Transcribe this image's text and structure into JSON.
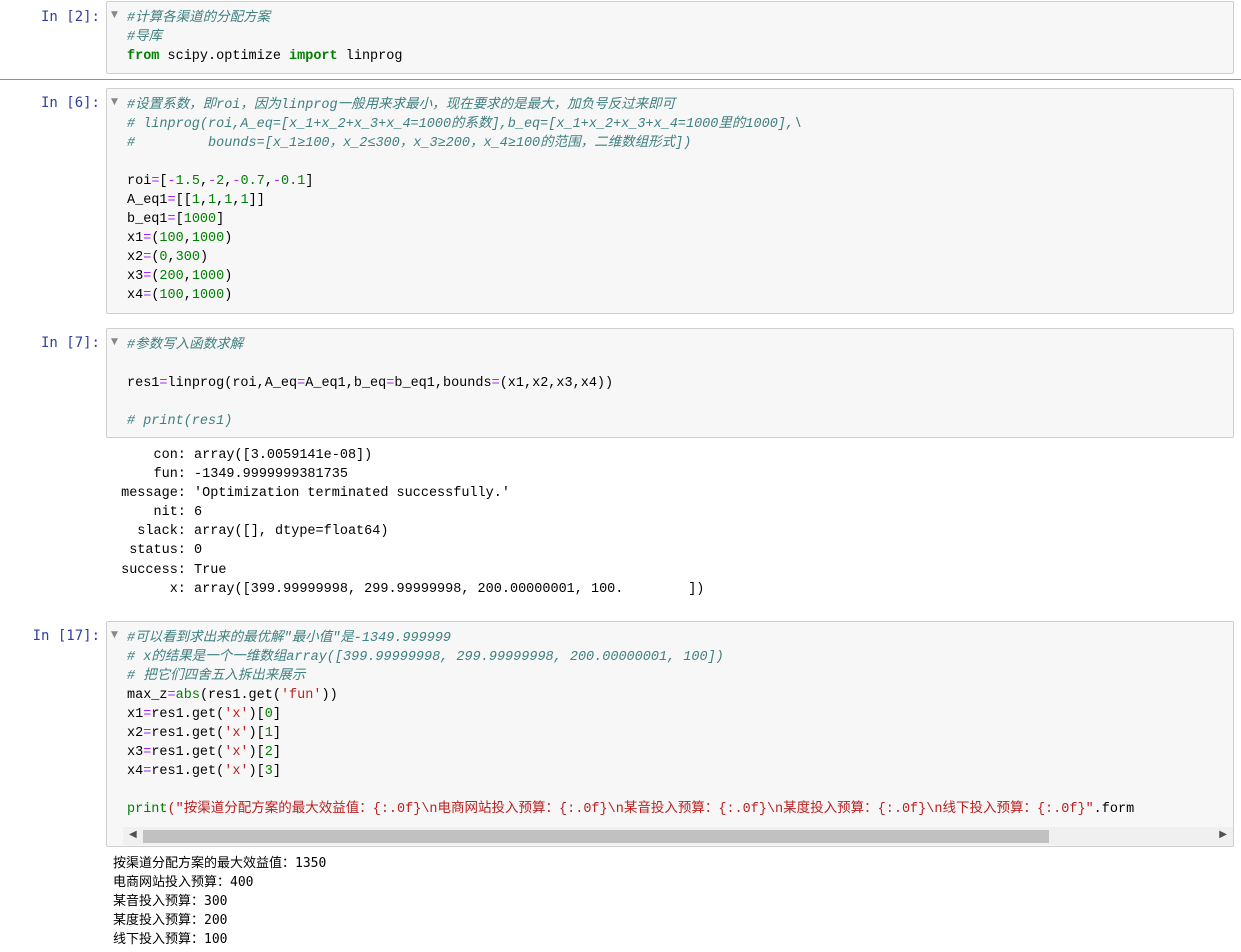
{
  "cells": [
    {
      "prompt": "In  [2]:",
      "lines": [
        [
          {
            "t": "#计算各渠道的分配方案",
            "c": "cm"
          }
        ],
        [
          {
            "t": "#导库",
            "c": "cm"
          }
        ],
        [
          {
            "t": "from",
            "c": "kw"
          },
          {
            "t": " scipy.optimize ",
            "c": ""
          },
          {
            "t": "import",
            "c": "kw"
          },
          {
            "t": " linprog",
            "c": ""
          }
        ]
      ]
    },
    {
      "prompt": "In  [6]:",
      "lines": [
        [
          {
            "t": "#设置系数，即roi，因为linprog一般用来求最小，现在要求的是最大，加负号反过来即可",
            "c": "cm"
          }
        ],
        [
          {
            "t": "# linprog(roi,A_eq=[x_1+x_2+x_3+x_4=1000的系数],b_eq=[x_1+x_2+x_3+x_4=1000里的1000],\\",
            "c": "cm"
          }
        ],
        [
          {
            "t": "#         bounds=[x_1≥100，x_2≤300，x_3≥200，x_4≥100的范围，二维数组形式])",
            "c": "cm"
          }
        ],
        [
          {
            "t": "",
            "c": ""
          }
        ],
        [
          {
            "t": "roi",
            "c": ""
          },
          {
            "t": "=",
            "c": "op"
          },
          {
            "t": "[",
            "c": ""
          },
          {
            "t": "-",
            "c": "op"
          },
          {
            "t": "1.5",
            "c": "num"
          },
          {
            "t": ",",
            "c": ""
          },
          {
            "t": "-",
            "c": "op"
          },
          {
            "t": "2",
            "c": "num"
          },
          {
            "t": ",",
            "c": ""
          },
          {
            "t": "-",
            "c": "op"
          },
          {
            "t": "0.7",
            "c": "num"
          },
          {
            "t": ",",
            "c": ""
          },
          {
            "t": "-",
            "c": "op"
          },
          {
            "t": "0.1",
            "c": "num"
          },
          {
            "t": "]",
            "c": ""
          }
        ],
        [
          {
            "t": "A_eq1",
            "c": ""
          },
          {
            "t": "=",
            "c": "op"
          },
          {
            "t": "[[",
            "c": ""
          },
          {
            "t": "1",
            "c": "num"
          },
          {
            "t": ",",
            "c": ""
          },
          {
            "t": "1",
            "c": "num"
          },
          {
            "t": ",",
            "c": ""
          },
          {
            "t": "1",
            "c": "num"
          },
          {
            "t": ",",
            "c": ""
          },
          {
            "t": "1",
            "c": "num"
          },
          {
            "t": "]]",
            "c": ""
          }
        ],
        [
          {
            "t": "b_eq1",
            "c": ""
          },
          {
            "t": "=",
            "c": "op"
          },
          {
            "t": "[",
            "c": ""
          },
          {
            "t": "1000",
            "c": "num"
          },
          {
            "t": "]",
            "c": ""
          }
        ],
        [
          {
            "t": "x1",
            "c": ""
          },
          {
            "t": "=",
            "c": "op"
          },
          {
            "t": "(",
            "c": ""
          },
          {
            "t": "100",
            "c": "num"
          },
          {
            "t": ",",
            "c": ""
          },
          {
            "t": "1000",
            "c": "num"
          },
          {
            "t": ")",
            "c": ""
          }
        ],
        [
          {
            "t": "x2",
            "c": ""
          },
          {
            "t": "=",
            "c": "op"
          },
          {
            "t": "(",
            "c": ""
          },
          {
            "t": "0",
            "c": "num"
          },
          {
            "t": ",",
            "c": ""
          },
          {
            "t": "300",
            "c": "num"
          },
          {
            "t": ")",
            "c": ""
          }
        ],
        [
          {
            "t": "x3",
            "c": ""
          },
          {
            "t": "=",
            "c": "op"
          },
          {
            "t": "(",
            "c": ""
          },
          {
            "t": "200",
            "c": "num"
          },
          {
            "t": ",",
            "c": ""
          },
          {
            "t": "1000",
            "c": "num"
          },
          {
            "t": ")",
            "c": ""
          }
        ],
        [
          {
            "t": "x4",
            "c": ""
          },
          {
            "t": "=",
            "c": "op"
          },
          {
            "t": "(",
            "c": ""
          },
          {
            "t": "100",
            "c": "num"
          },
          {
            "t": ",",
            "c": ""
          },
          {
            "t": "1000",
            "c": "num"
          },
          {
            "t": ")",
            "c": ""
          }
        ]
      ]
    },
    {
      "prompt": "In  [7]:",
      "lines": [
        [
          {
            "t": "#参数写入函数求解",
            "c": "cm"
          }
        ],
        [
          {
            "t": "",
            "c": ""
          }
        ],
        [
          {
            "t": "res1",
            "c": ""
          },
          {
            "t": "=",
            "c": "op"
          },
          {
            "t": "linprog(roi,A_eq",
            "c": ""
          },
          {
            "t": "=",
            "c": "op"
          },
          {
            "t": "A_eq1,b_eq",
            "c": ""
          },
          {
            "t": "=",
            "c": "op"
          },
          {
            "t": "b_eq1,bounds",
            "c": ""
          },
          {
            "t": "=",
            "c": "op"
          },
          {
            "t": "(x1,x2,x3,x4))",
            "c": ""
          }
        ],
        [
          {
            "t": "",
            "c": ""
          }
        ],
        [
          {
            "t": "# print(res1)",
            "c": "cm"
          }
        ]
      ],
      "output": [
        "     con: array([3.0059141e-08])",
        "     fun: -1349.9999999381735",
        " message: 'Optimization terminated successfully.'",
        "     nit: 6",
        "   slack: array([], dtype=float64)",
        "  status: 0",
        " success: True",
        "       x: array([399.99999998, 299.99999998, 200.00000001, 100.        ])"
      ]
    },
    {
      "prompt": "In  [17]:",
      "lines": [
        [
          {
            "t": "#可以看到求出来的最优解\"最小值\"是-1349.999999",
            "c": "cm"
          }
        ],
        [
          {
            "t": "# x的结果是一个一维数组array([399.99999998, 299.99999998, 200.00000001, 100])",
            "c": "cm"
          }
        ],
        [
          {
            "t": "# 把它们四舍五入拆出来展示",
            "c": "cm"
          }
        ],
        [
          {
            "t": "max_z",
            "c": ""
          },
          {
            "t": "=",
            "c": "op"
          },
          {
            "t": "abs",
            "c": "bi"
          },
          {
            "t": "(res1.get(",
            "c": ""
          },
          {
            "t": "'fun'",
            "c": "str"
          },
          {
            "t": "))",
            "c": ""
          }
        ],
        [
          {
            "t": "x1",
            "c": ""
          },
          {
            "t": "=",
            "c": "op"
          },
          {
            "t": "res1.get(",
            "c": ""
          },
          {
            "t": "'x'",
            "c": "str"
          },
          {
            "t": ")[",
            "c": ""
          },
          {
            "t": "0",
            "c": "num"
          },
          {
            "t": "]",
            "c": ""
          }
        ],
        [
          {
            "t": "x2",
            "c": ""
          },
          {
            "t": "=",
            "c": "op"
          },
          {
            "t": "res1.get(",
            "c": ""
          },
          {
            "t": "'x'",
            "c": "str"
          },
          {
            "t": ")[",
            "c": ""
          },
          {
            "t": "1",
            "c": "num"
          },
          {
            "t": "]",
            "c": ""
          }
        ],
        [
          {
            "t": "x3",
            "c": ""
          },
          {
            "t": "=",
            "c": "op"
          },
          {
            "t": "res1.get(",
            "c": ""
          },
          {
            "t": "'x'",
            "c": "str"
          },
          {
            "t": ")[",
            "c": ""
          },
          {
            "t": "2",
            "c": "num"
          },
          {
            "t": "]",
            "c": ""
          }
        ],
        [
          {
            "t": "x4",
            "c": ""
          },
          {
            "t": "=",
            "c": "op"
          },
          {
            "t": "res1.get(",
            "c": ""
          },
          {
            "t": "'x'",
            "c": "str"
          },
          {
            "t": ")[",
            "c": ""
          },
          {
            "t": "3",
            "c": "num"
          },
          {
            "t": "]",
            "c": ""
          }
        ],
        [
          {
            "t": "",
            "c": ""
          }
        ],
        [
          {
            "t": "print",
            "c": "bi"
          },
          {
            "t": "(\"按渠道分配方案的最大效益值：{:.0f}\\n电商网站投入预算：{:.0f}\\n某音投入预算：{:.0f}\\n某度投入预算：{:.0f}\\n线下投入预算：{:.0f}\"",
            "c": "str"
          },
          {
            "t": ".form",
            "c": ""
          }
        ]
      ],
      "output": [
        "按渠道分配方案的最大效益值：1350",
        "电商网站投入预算：400",
        "某音投入预算：300",
        "某度投入预算：200",
        "线下投入预算：100"
      ]
    }
  ],
  "scrollbar": {
    "left_arrow": "◀",
    "right_arrow": "▶"
  }
}
